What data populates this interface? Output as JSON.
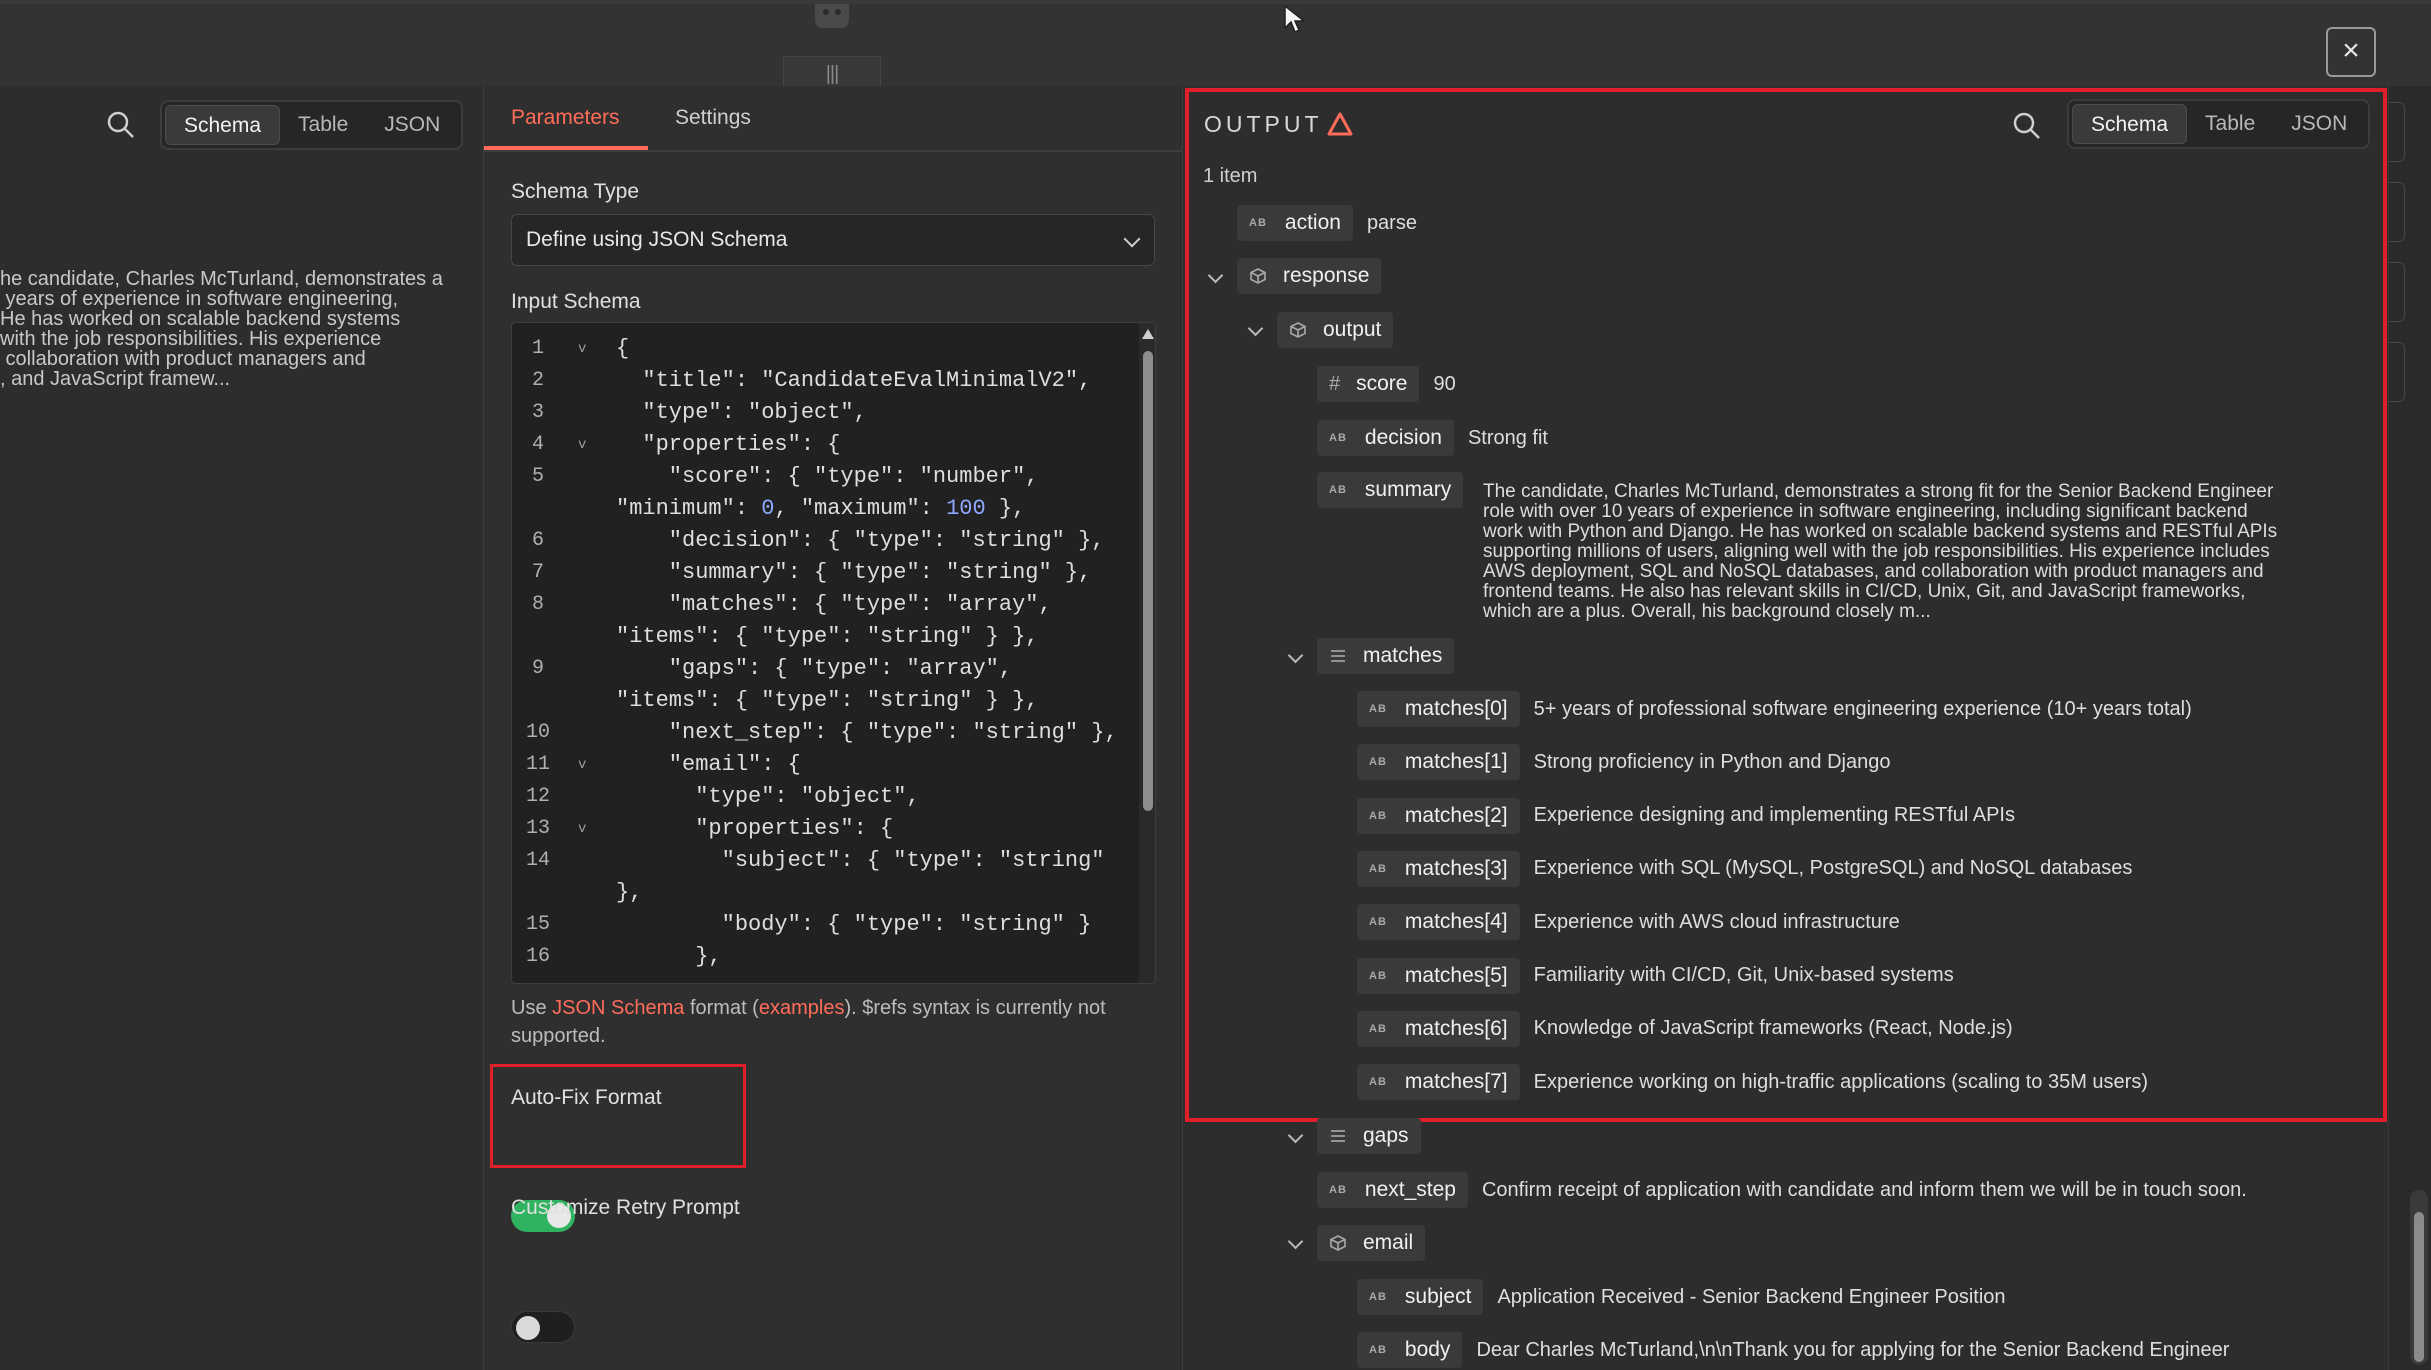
{
  "window": {
    "close_label": "×"
  },
  "input_panel": {
    "view_toggle": [
      "Schema",
      "Table",
      "JSON"
    ],
    "active_view": "Schema",
    "text_lines": [
      "he candidate, Charles McTurland, demonstrates a",
      " years of experience in software engineering,",
      "He has worked on scalable backend systems",
      "with the job responsibilities. His experience",
      " collaboration with product managers and",
      ", and JavaScript framew..."
    ]
  },
  "parameters_panel": {
    "tabs": {
      "parameters": "Parameters",
      "settings": "Settings"
    },
    "schema_type": {
      "label": "Schema Type",
      "value": "Define using JSON Schema"
    },
    "input_schema": {
      "label": "Input Schema",
      "lines": [
        {
          "n": "1",
          "fold": true,
          "text": "{"
        },
        {
          "n": "2",
          "fold": false,
          "text": "  \"title\": \"CandidateEvalMinimalV2\","
        },
        {
          "n": "3",
          "fold": false,
          "text": "  \"type\": \"object\","
        },
        {
          "n": "4",
          "fold": true,
          "text": "  \"properties\": {"
        },
        {
          "n": "5",
          "fold": false,
          "text": "    \"score\": { \"type\": \"number\","
        },
        {
          "n": "",
          "fold": false,
          "text": "\"minimum\": 0, \"maximum\": 100 },"
        },
        {
          "n": "6",
          "fold": false,
          "text": "    \"decision\": { \"type\": \"string\" },"
        },
        {
          "n": "7",
          "fold": false,
          "text": "    \"summary\": { \"type\": \"string\" },"
        },
        {
          "n": "8",
          "fold": false,
          "text": "    \"matches\": { \"type\": \"array\","
        },
        {
          "n": "",
          "fold": false,
          "text": "\"items\": { \"type\": \"string\" } },"
        },
        {
          "n": "9",
          "fold": false,
          "text": "    \"gaps\": { \"type\": \"array\","
        },
        {
          "n": "",
          "fold": false,
          "text": "\"items\": { \"type\": \"string\" } },"
        },
        {
          "n": "10",
          "fold": false,
          "text": "    \"next_step\": { \"type\": \"string\" },"
        },
        {
          "n": "11",
          "fold": true,
          "text": "    \"email\": {"
        },
        {
          "n": "12",
          "fold": false,
          "text": "      \"type\": \"object\","
        },
        {
          "n": "13",
          "fold": true,
          "text": "      \"properties\": {"
        },
        {
          "n": "14",
          "fold": false,
          "text": "        \"subject\": { \"type\": \"string\""
        },
        {
          "n": "",
          "fold": false,
          "text": "},"
        },
        {
          "n": "15",
          "fold": false,
          "text": "        \"body\": { \"type\": \"string\" }"
        },
        {
          "n": "16",
          "fold": false,
          "text": "      },"
        }
      ]
    },
    "hint": {
      "prefix": "Use ",
      "link1": "JSON Schema",
      "middle": " format (",
      "link2": "examples",
      "suffix": "). $refs syntax is currently not supported."
    },
    "auto_fix": {
      "label": "Auto-Fix Format",
      "enabled": true
    },
    "retry_prompt": {
      "label": "Customize Retry Prompt",
      "enabled": false
    }
  },
  "output_panel": {
    "title": "OUTPUT",
    "item_count": "1 item",
    "view_toggle": [
      "Schema",
      "Table",
      "JSON"
    ],
    "active_view": "Schema",
    "type_abbrev": "AB",
    "tree": {
      "action": {
        "key": "action",
        "value": "parse"
      },
      "response": {
        "key": "response"
      },
      "output": {
        "key": "output"
      },
      "score": {
        "key": "score",
        "value": "90"
      },
      "decision": {
        "key": "decision",
        "value": "Strong fit"
      },
      "summary": {
        "key": "summary",
        "lines": [
          "The candidate, Charles McTurland, demonstrates a strong fit for the Senior Backend Engineer",
          "role with over 10 years of experience in software engineering, including significant backend",
          "work with Python and Django. He has worked on scalable backend systems and RESTful APIs",
          "supporting millions of users, aligning well with the job responsibilities. His experience includes",
          "AWS deployment, SQL and NoSQL databases, and collaboration with product managers and",
          "frontend teams. He also has relevant skills in CI/CD, Unix, Git, and JavaScript frameworks,",
          "which are a plus. Overall, his background closely m..."
        ]
      },
      "matches": {
        "key": "matches",
        "items": [
          {
            "key": "matches[0]",
            "value": "5+ years of professional software engineering experience (10+ years total)"
          },
          {
            "key": "matches[1]",
            "value": "Strong proficiency in Python and Django"
          },
          {
            "key": "matches[2]",
            "value": "Experience designing and implementing RESTful APIs"
          },
          {
            "key": "matches[3]",
            "value": "Experience with SQL (MySQL, PostgreSQL) and NoSQL databases"
          },
          {
            "key": "matches[4]",
            "value": "Experience with AWS cloud infrastructure"
          },
          {
            "key": "matches[5]",
            "value": "Familiarity with CI/CD, Git, Unix-based systems"
          },
          {
            "key": "matches[6]",
            "value": "Knowledge of JavaScript frameworks (React, Node.js)"
          },
          {
            "key": "matches[7]",
            "value": "Experience working on high-traffic applications (scaling to 35M users)"
          }
        ]
      },
      "gaps": {
        "key": "gaps"
      },
      "next_step": {
        "key": "next_step",
        "value": "Confirm receipt of application with candidate and inform them we will be in touch soon."
      },
      "email": {
        "key": "email"
      },
      "subject": {
        "key": "subject",
        "value": "Application Received - Senior Backend Engineer Position"
      },
      "body": {
        "key": "body",
        "value": "Dear Charles McTurland,\\n\\nThank you for applying for the Senior Backend Engineer"
      }
    }
  },
  "colors": {
    "accent": "#ff6d5a",
    "highlight_border": "#e11f2a",
    "toggle_on": "#2fb360"
  }
}
